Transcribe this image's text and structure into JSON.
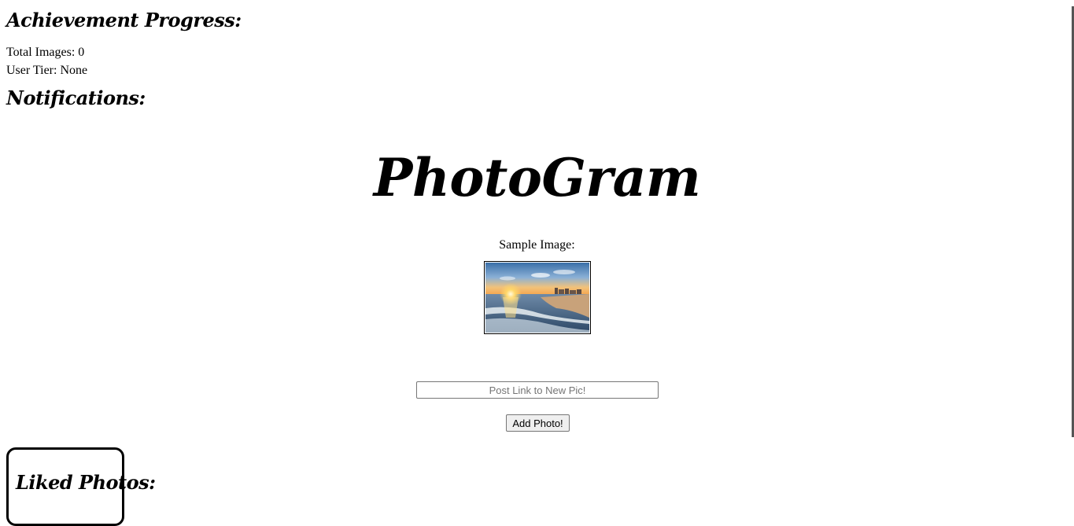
{
  "achievements": {
    "heading": "Achievement Progress:",
    "total_images_label": "Total Images: 0",
    "user_tier_label": "User Tier: None"
  },
  "notifications": {
    "heading": "Notifications:"
  },
  "brand": {
    "title": "PhotoGram"
  },
  "sample": {
    "label": "Sample Image:",
    "image_alt": "Sunset over beach with waves"
  },
  "add_photo": {
    "input_placeholder": "Post Link to New Pic!",
    "input_value": "",
    "button_label": "Add Photo!"
  },
  "liked": {
    "heading": "Liked Photos:"
  },
  "colors": {
    "background": "#ffffff",
    "text": "#000000",
    "button_bg": "#efefef"
  }
}
